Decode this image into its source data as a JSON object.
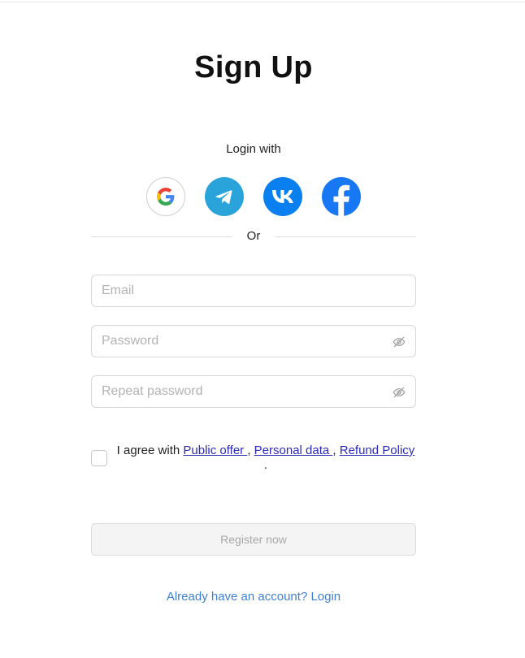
{
  "page": {
    "title": "Sign Up",
    "login_with": "Login with",
    "or": "Or"
  },
  "social": {
    "google": "google-icon",
    "telegram": "telegram-icon",
    "vk": "vk-icon",
    "facebook": "facebook-icon"
  },
  "form": {
    "email_placeholder": "Email",
    "password_placeholder": "Password",
    "repeat_placeholder": "Repeat password"
  },
  "agreement": {
    "prefix": "I agree with ",
    "public_offer": "Public offer ",
    "comma1": ", ",
    "personal_data": "Personal data ",
    "comma2": ", ",
    "refund_policy": "Refund Policy ",
    "suffix": "."
  },
  "actions": {
    "register": "Register now",
    "already": "Already have an account? Login"
  },
  "colors": {
    "telegram": "#2AA3DB",
    "vk": "#0A7FF0",
    "facebook": "#1877F2",
    "link": "#3f7fd6"
  }
}
